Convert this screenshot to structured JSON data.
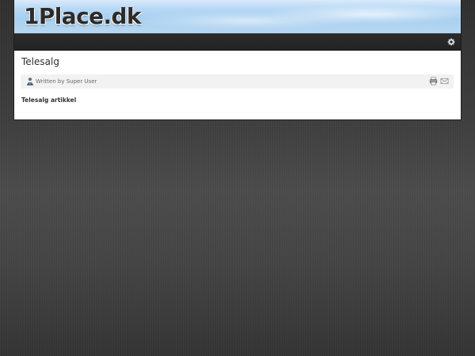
{
  "site": {
    "logo_text": "1Place.dk"
  },
  "toolbar": {
    "settings_icon": "gear-icon"
  },
  "article": {
    "title": "Telesalg",
    "meta": {
      "written_by": "Written by Super User",
      "author_icon": "user-icon",
      "print_icon": "printer-icon",
      "email_icon": "email-icon"
    },
    "body": "Telesalg artikkel"
  },
  "colors": {
    "header_sky": "#b9d9f5",
    "toolbar_dark": "#262626",
    "content_white": "#ffffff",
    "meta_bar": "#f2f2f2",
    "page_background": "#444444"
  }
}
